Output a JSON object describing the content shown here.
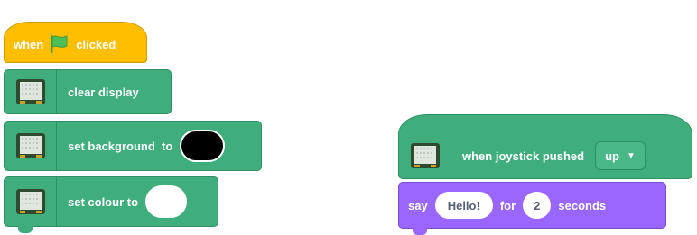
{
  "script_left": {
    "hat": {
      "when_label": "when",
      "clicked_label": "clicked",
      "icon": "green-flag-icon",
      "color": "#ffbf00"
    },
    "blocks": [
      {
        "label": "clear display",
        "icon": "sense-hat-icon"
      },
      {
        "label": "set background  to",
        "icon": "sense-hat-icon",
        "input_color": "#000000"
      },
      {
        "label": "set colour to",
        "icon": "sense-hat-icon",
        "input_color": "#ffffff"
      }
    ],
    "color": "#3fae7c"
  },
  "script_right": {
    "hat": {
      "label": "when joystick pushed",
      "dropdown_value": "up",
      "icon": "sense-hat-icon"
    },
    "say": {
      "say_label": "say",
      "message": "Hello!",
      "for_label": "for",
      "seconds_value": "2",
      "seconds_label": "seconds",
      "color": "#9966ff"
    }
  }
}
